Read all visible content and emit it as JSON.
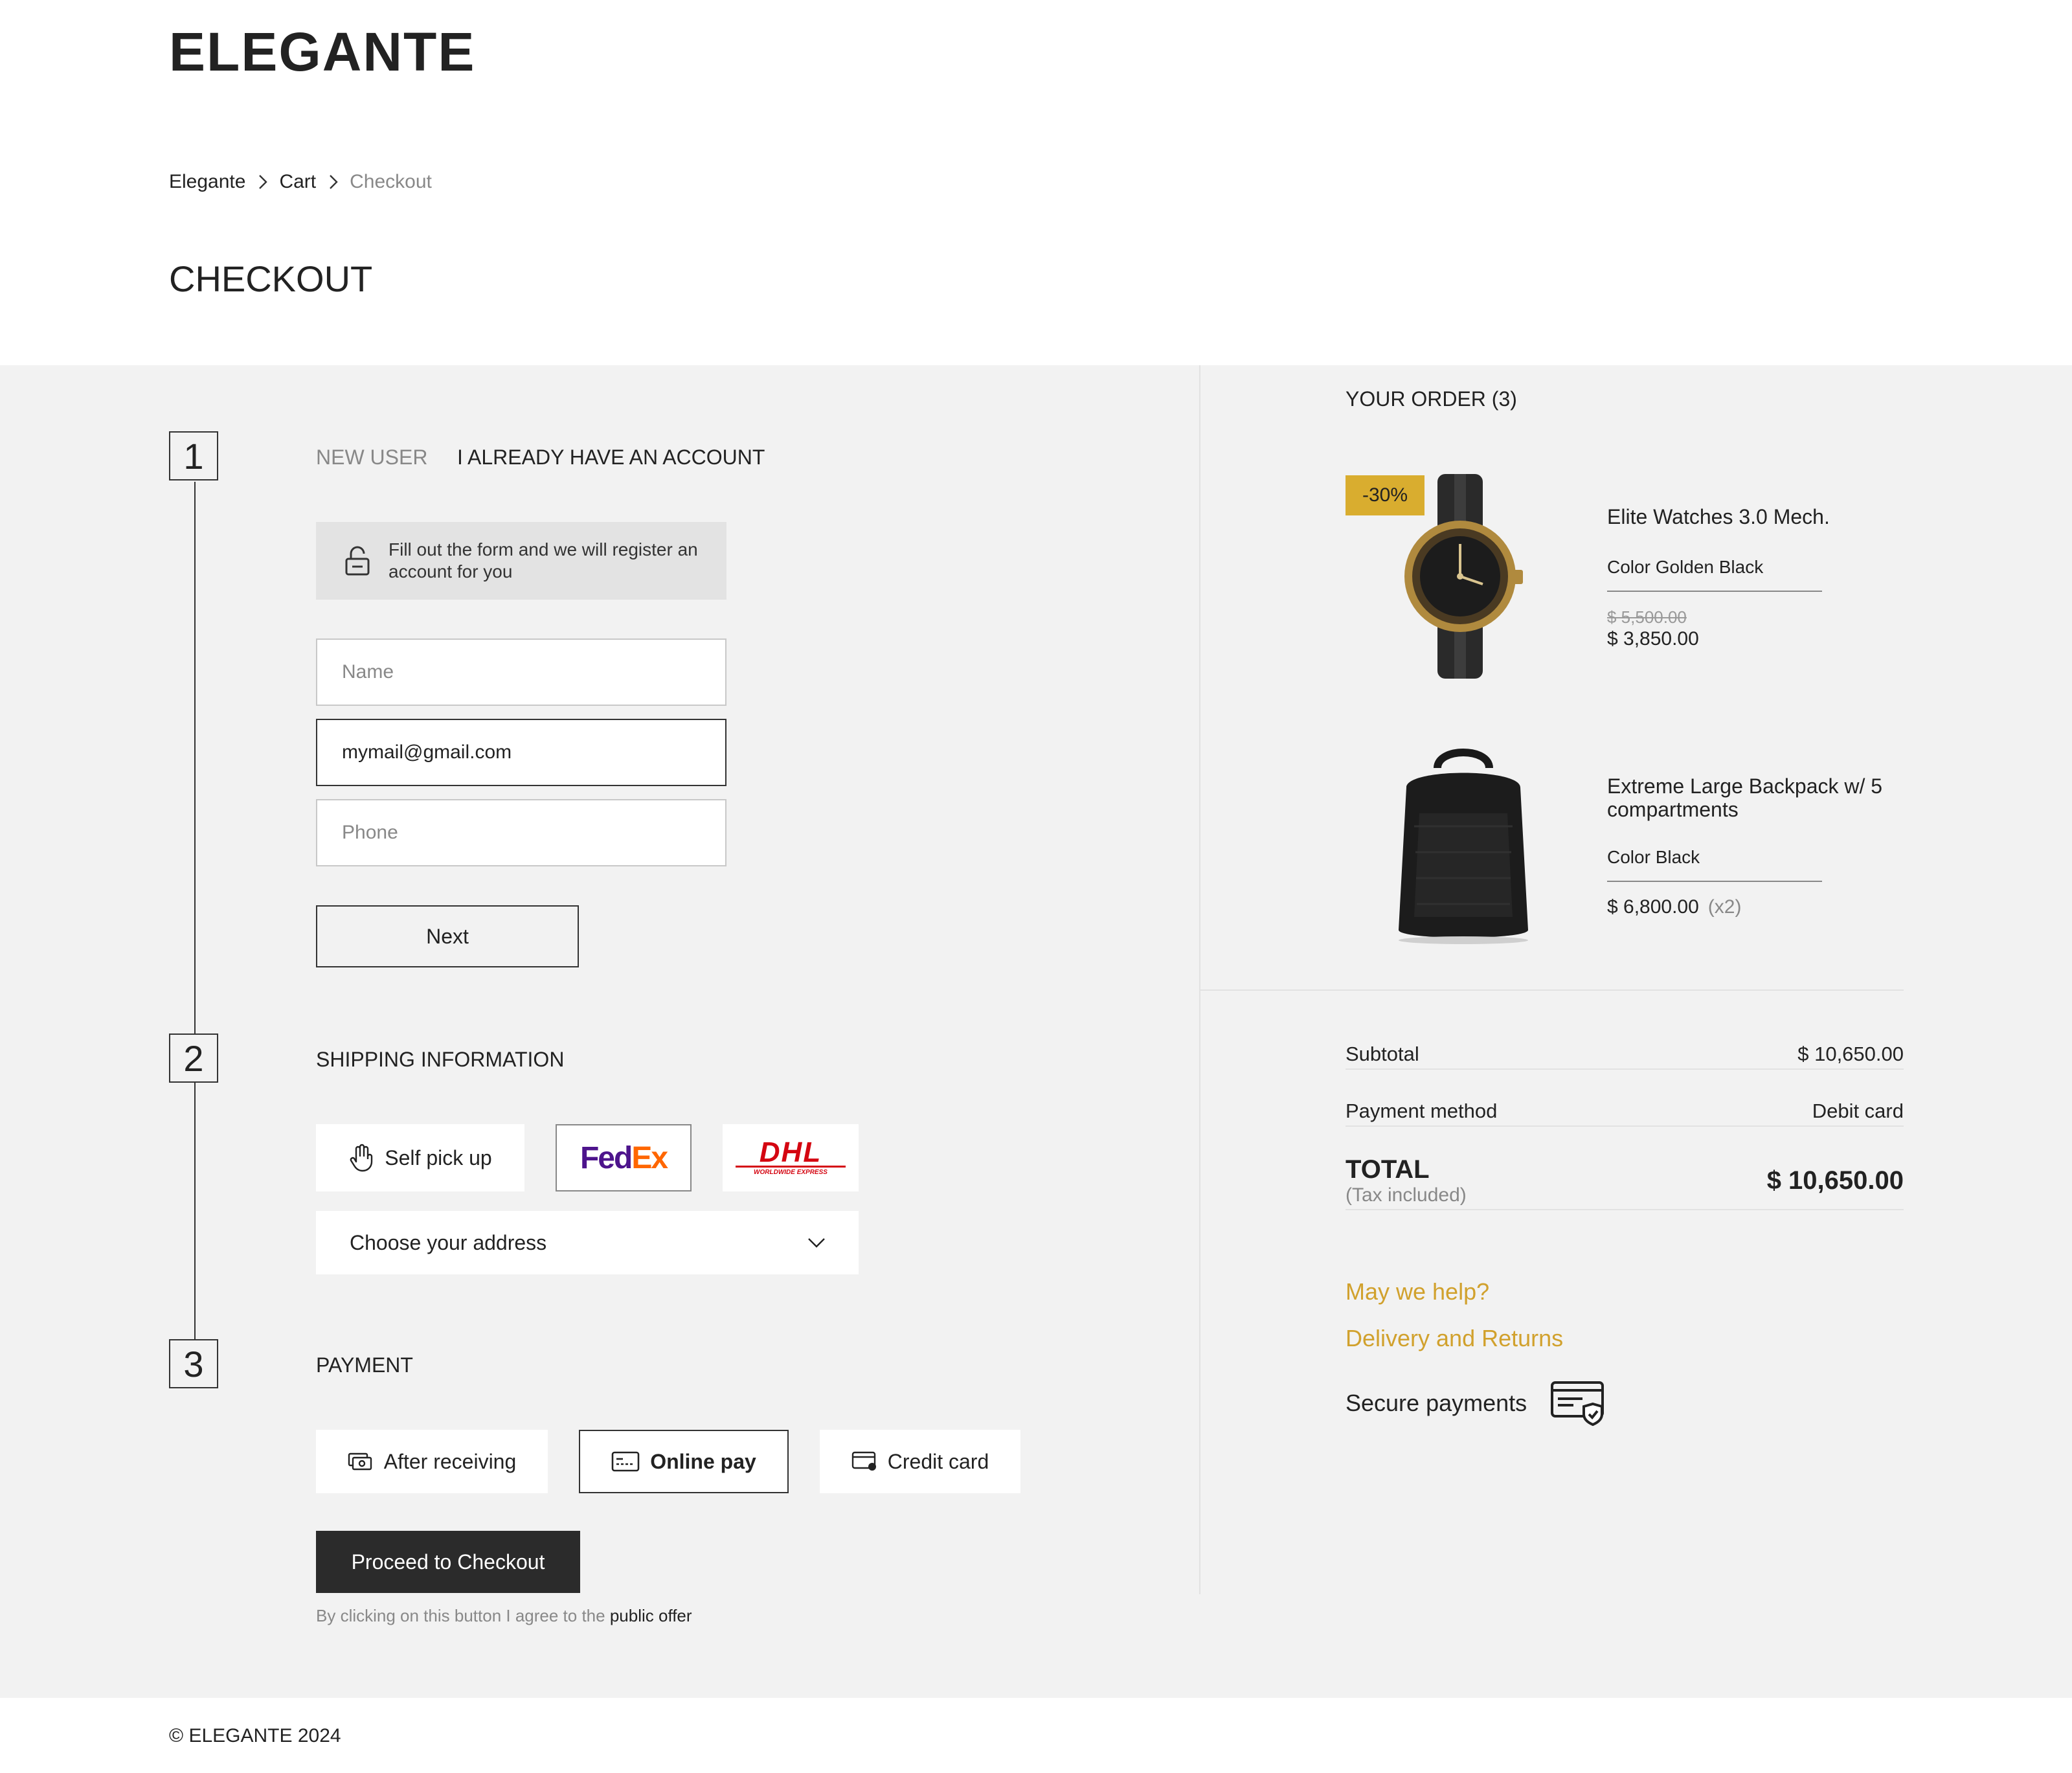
{
  "brand": "ELEGANTE",
  "breadcrumb": {
    "items": [
      "Elegante",
      "Cart"
    ],
    "current": "Checkout"
  },
  "page_title": "CHECKOUT",
  "steps": {
    "one": "1",
    "two": "2",
    "three": "3"
  },
  "account_tabs": {
    "new_user": "NEW USER",
    "have_account": "I ALREADY HAVE AN ACCOUNT"
  },
  "notice": "Fill out the form and we will register an account for you",
  "form": {
    "name_placeholder": "Name",
    "email_value": "mymail@gmail.com",
    "phone_placeholder": "Phone",
    "next_label": "Next"
  },
  "shipping": {
    "title": "SHIPPING INFORMATION",
    "self_pickup": "Self pick up",
    "fedex_fed": "Fed",
    "fedex_ex": "Ex",
    "dhl": "DHL",
    "dhl_sub": "WORLDWIDE EXPRESS",
    "address_placeholder": "Choose your address"
  },
  "payment": {
    "title": "PAYMENT",
    "after_receiving": "After receiving",
    "online_pay": "Online pay",
    "credit_card": "Credit card",
    "proceed": "Proceed to Checkout",
    "agree_text": "By clicking on this button I agree to the ",
    "agree_link": "public offer"
  },
  "order": {
    "title": "YOUR ORDER (3)",
    "items": [
      {
        "badge": "-30%",
        "name": "Elite Watches 3.0 Mech.",
        "color": "Color Golden Black",
        "old_price": "$ 5,500.00",
        "price": "$ 3,850.00"
      },
      {
        "name": "Extreme Large Backpack w/ 5 compartments",
        "color": "Color Black",
        "price": "$ 6,800.00",
        "qty": "(x2)"
      }
    ],
    "subtotal_label": "Subtotal",
    "subtotal_value": "$ 10,650.00",
    "payment_method_label": "Payment method",
    "payment_method_value": "Debit card",
    "total_label": "TOTAL",
    "tax_note": "(Tax included)",
    "total_value": "$ 10,650.00"
  },
  "help": {
    "may_we_help": "May we help?",
    "delivery_returns": "Delivery and Returns",
    "secure_payments": "Secure payments"
  },
  "footer": "© ELEGANTE 2024",
  "colors": {
    "accent": "#d1a12d",
    "badge": "#d9ad2f",
    "dark": "#2b2b2b",
    "band": "#f2f2f2"
  }
}
